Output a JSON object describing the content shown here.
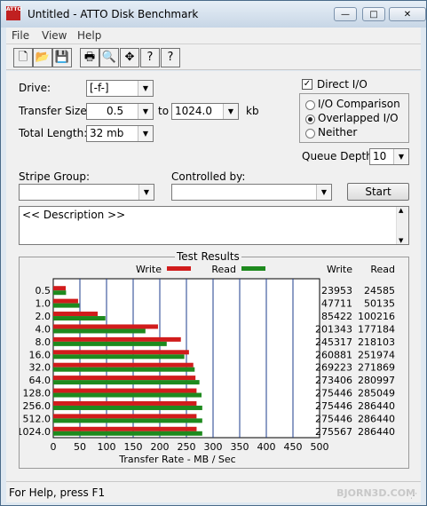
{
  "app": {
    "icon_text": "ATTO",
    "title": "Untitled - ATTO Disk Benchmark"
  },
  "window_controls": {
    "minimize": "—",
    "maximize": "□",
    "close": "✕"
  },
  "menu": [
    "File",
    "View",
    "Help"
  ],
  "toolbar": {
    "icons": [
      "new-document-icon",
      "open-folder-icon",
      "save-icon",
      "print-icon",
      "print-preview-icon",
      "move-icon",
      "help-icon",
      "context-help-icon"
    ],
    "glyphs": [
      "🗋",
      "📂",
      "💾",
      "🖶",
      "🔍",
      "✥",
      "?",
      "?"
    ]
  },
  "settings": {
    "drive_label": "Drive:",
    "drive_value": "[-f-]",
    "transfer_size_label": "Transfer Size:",
    "transfer_from": "0.5",
    "to_label": "to",
    "transfer_to": "1024.0",
    "kb_label": "kb",
    "total_length_label": "Total Length:",
    "total_length_value": "32 mb",
    "direct_io_label": "Direct I/O",
    "direct_io_checked": true,
    "mode_options": [
      "I/O Comparison",
      "Overlapped I/O",
      "Neither"
    ],
    "mode_selected": "Overlapped I/O",
    "queue_depth_label": "Queue Depth:",
    "queue_depth_value": "10",
    "stripe_group_label": "Stripe Group:",
    "stripe_group_value": "",
    "controlled_by_label": "Controlled by:",
    "controlled_by_value": "",
    "start_label": "Start",
    "description": "<< Description >>"
  },
  "results": {
    "title": "Test Results",
    "write_legend": "Write",
    "read_legend": "Read",
    "write_col_header": "Write",
    "read_col_header": "Read",
    "write_color": "#d11c1c",
    "read_color": "#1e8a1e"
  },
  "chart_data": {
    "type": "bar",
    "orientation": "horizontal",
    "categories": [
      "0.5",
      "1.0",
      "2.0",
      "4.0",
      "8.0",
      "16.0",
      "32.0",
      "64.0",
      "128.0",
      "256.0",
      "512.0",
      "1024.0"
    ],
    "series": [
      {
        "name": "Write",
        "values": [
          23953,
          47711,
          85422,
          201343,
          245317,
          260881,
          269223,
          273406,
          275446,
          275446,
          275446,
          275567
        ]
      },
      {
        "name": "Read",
        "values": [
          24585,
          50135,
          100216,
          177184,
          218103,
          251974,
          271869,
          280997,
          285049,
          286440,
          286440,
          286440
        ]
      }
    ],
    "xlabel": "Transfer Rate - MB / Sec",
    "ylabel": "",
    "xlim": [
      0,
      500
    ],
    "x_ticks": [
      "0",
      "50",
      "100",
      "150",
      "200",
      "250",
      "300",
      "350",
      "400",
      "450",
      "500"
    ],
    "grid": true
  },
  "status": {
    "text": "For Help, press F1"
  },
  "watermark": "BJORN3D.COM"
}
